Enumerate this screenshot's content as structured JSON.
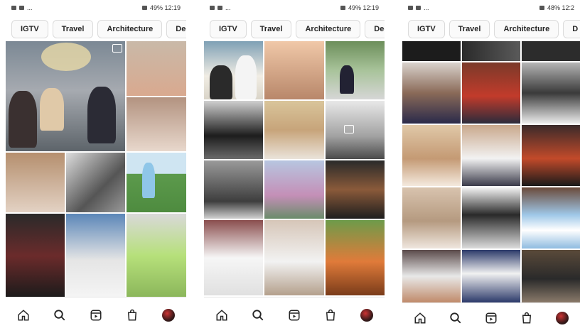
{
  "screens": [
    {
      "status_left": "...",
      "status_right": "49%  12:19",
      "chips": [
        "IGTV",
        "Travel",
        "Architecture",
        "Dec"
      ]
    },
    {
      "status_left": "...",
      "status_right": "49%  12:19",
      "chips": [
        "IGTV",
        "Travel",
        "Architecture",
        "Dec"
      ]
    },
    {
      "status_left": "...",
      "status_right": "48%  12:2",
      "chips": [
        "IGTV",
        "Travel",
        "Architecture",
        "D"
      ]
    }
  ],
  "tabbar_icons": [
    "home-icon",
    "search-icon",
    "reels-icon",
    "shop-icon",
    "profile-avatar"
  ]
}
